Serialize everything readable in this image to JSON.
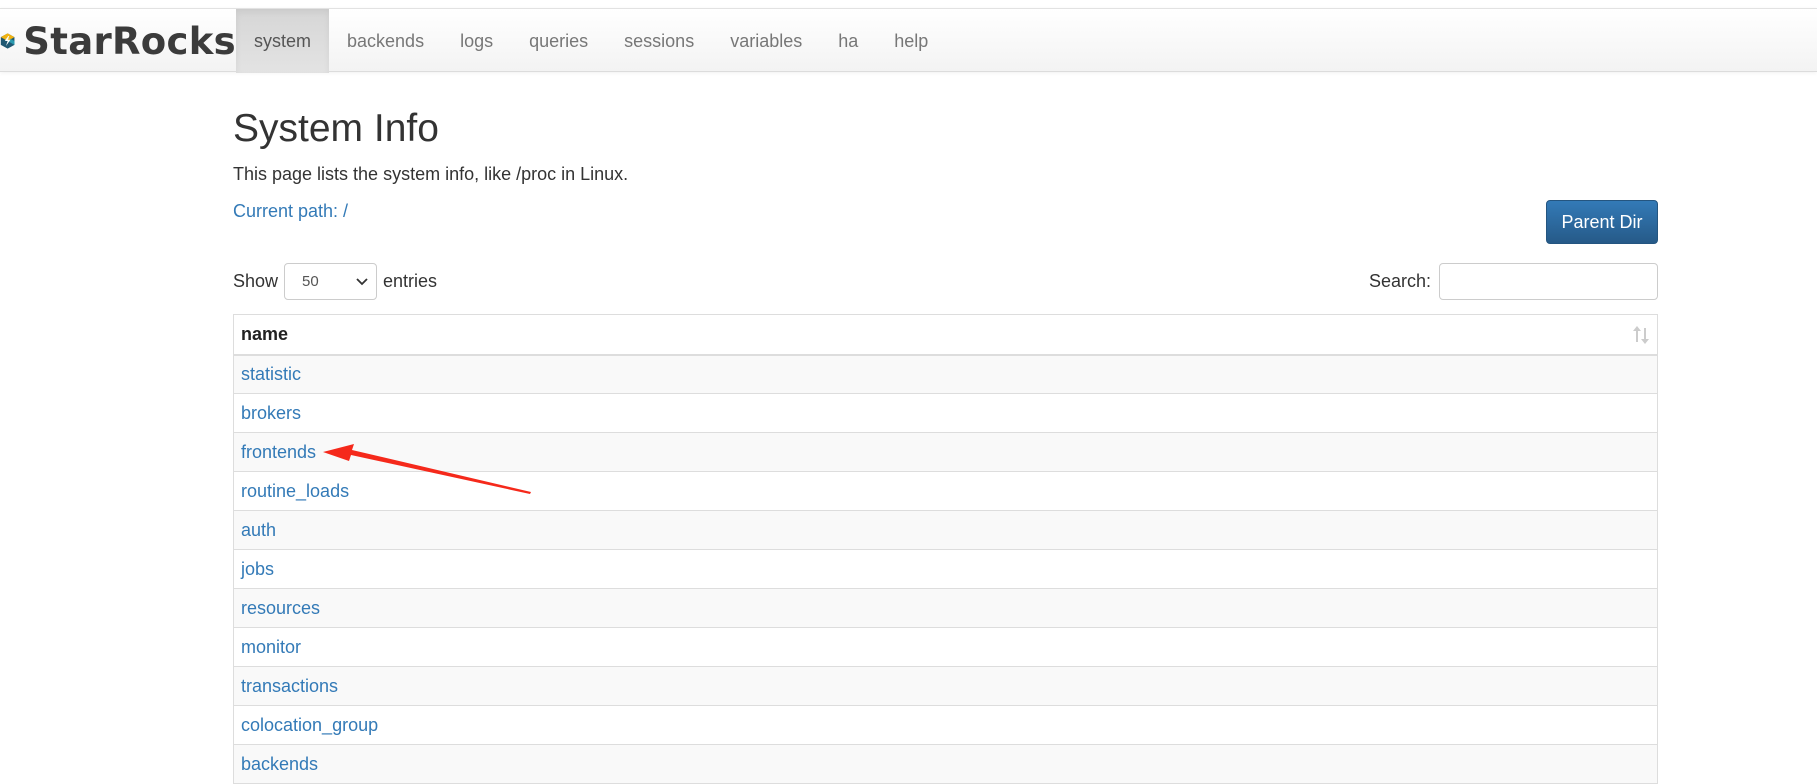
{
  "brand": {
    "name": "StarRocks"
  },
  "nav": {
    "items": [
      {
        "label": "system",
        "active": true
      },
      {
        "label": "backends"
      },
      {
        "label": "logs"
      },
      {
        "label": "queries"
      },
      {
        "label": "sessions"
      },
      {
        "label": "variables"
      },
      {
        "label": "ha"
      },
      {
        "label": "help"
      }
    ]
  },
  "page": {
    "title": "System Info",
    "description": "This page lists the system info, like /proc in Linux.",
    "current_path": "Current path: /",
    "parent_dir_label": "Parent Dir"
  },
  "table_controls": {
    "show_label": "Show",
    "page_length": "50",
    "entries_label": "entries",
    "search_label": "Search:",
    "search_value": ""
  },
  "table": {
    "header": "name",
    "rows": [
      "statistic",
      "brokers",
      "frontends",
      "routine_loads",
      "auth",
      "jobs",
      "resources",
      "monitor",
      "transactions",
      "colocation_group",
      "backends"
    ]
  },
  "colors": {
    "link": "#337ab7",
    "button": "#286090",
    "annotation_arrow": "#f5291b"
  },
  "icons": {
    "logo": "starrocks-logo-icon",
    "select_caret": "chevron-down-icon",
    "sort": "sort-both-icon",
    "annotation": "red-arrow-icon"
  }
}
